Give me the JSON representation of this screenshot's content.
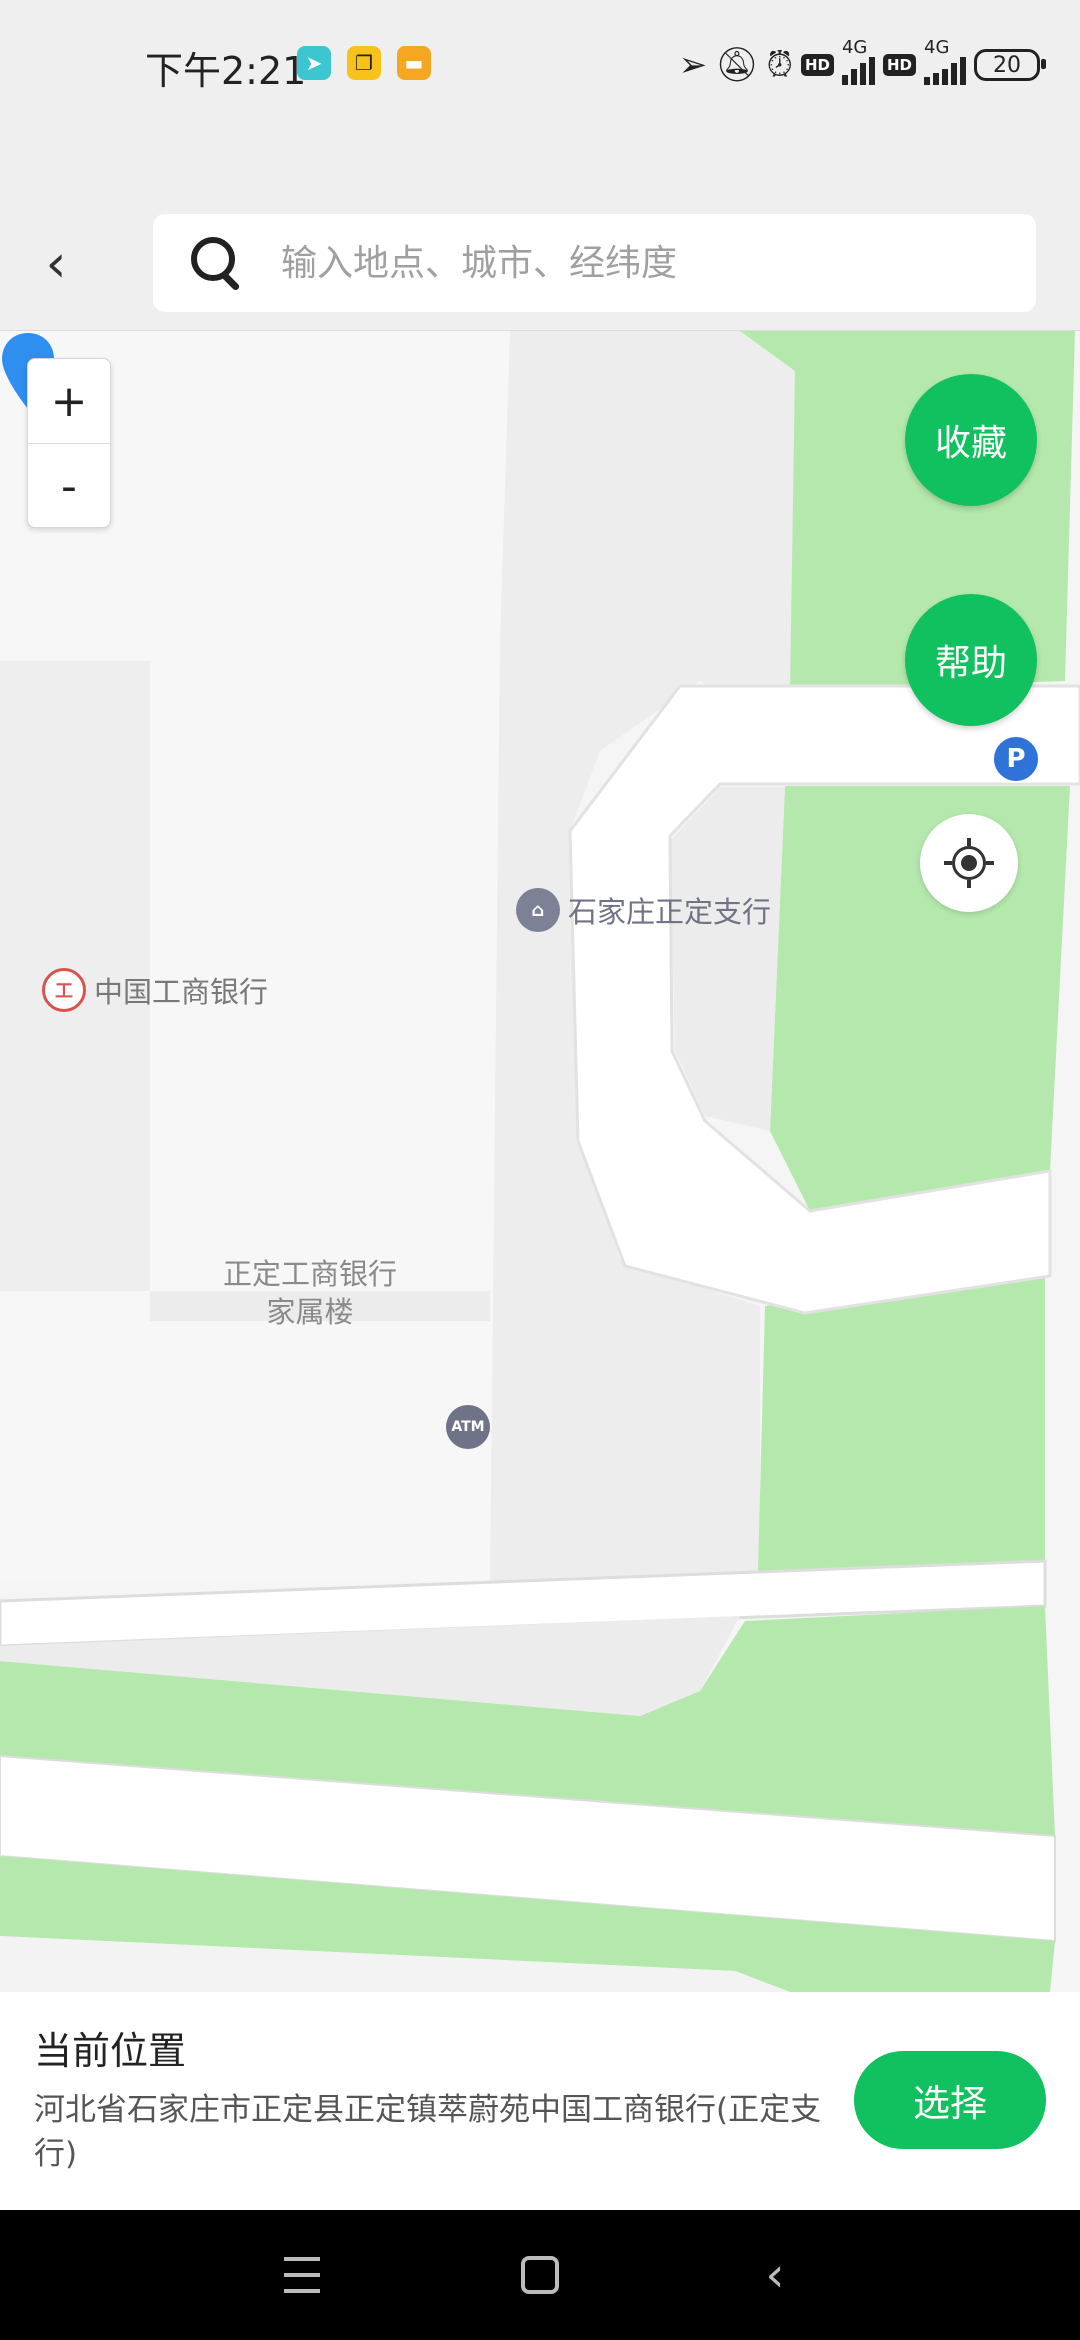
{
  "status_bar": {
    "time": "下午2:21",
    "network_1": "4G",
    "network_2": "4G",
    "hd_label": "HD",
    "battery": "20"
  },
  "header": {
    "back_icon": "chevron-left-icon",
    "search_placeholder": "输入地点、城市、经纬度"
  },
  "map": {
    "zoom_in": "+",
    "zoom_out": "-",
    "favorite_button": "收藏",
    "help_button": "帮助",
    "parking_label": "P",
    "atm_label": "ATM",
    "pois": {
      "bank_branch": "石家庄正定支行",
      "icbc": "中国工商银行",
      "building_line1": "正定工商银行",
      "building_line2": "家属楼"
    },
    "colors": {
      "green_area": "#b5e8ad",
      "road": "#ffffff",
      "block": "#eeeeee",
      "pin": "#2f8ff0"
    }
  },
  "bottom_panel": {
    "title": "当前位置",
    "address": "河北省石家庄市正定县正定镇萃蔚苑中国工商银行(正定支行)",
    "select_button": "选择",
    "accent_color": "#11c15f"
  },
  "nav_bar": {
    "menu_icon": "menu-icon",
    "home_icon": "home-icon",
    "back_icon": "back-icon"
  }
}
